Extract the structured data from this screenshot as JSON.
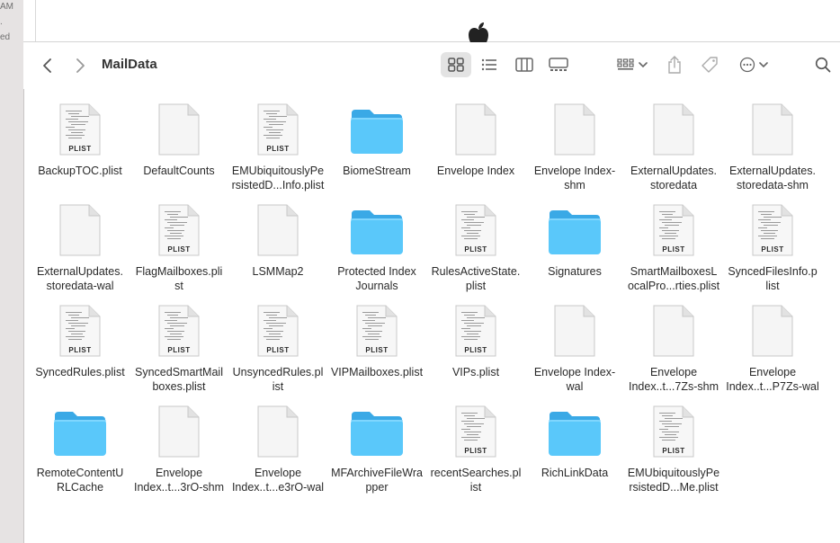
{
  "behind_window": {
    "left_fragments": [
      "AM",
      ".",
      "ed"
    ]
  },
  "toolbar": {
    "title": "MailData",
    "back_icon": "chevron-left-icon",
    "forward_icon": "chevron-right-icon",
    "view_icons": [
      "icon-view-icon",
      "list-view-icon",
      "column-view-icon",
      "gallery-view-icon"
    ],
    "active_view": "icon-view-icon",
    "group_icon": "group-by-icon",
    "share_icon": "share-icon",
    "tag_icon": "tag-icon",
    "more_icon": "more-actions-icon",
    "search_icon": "search-icon"
  },
  "colors": {
    "folder": "#5ac8fa",
    "folder_tab": "#3aa9e6",
    "selected_view_bg": "#e3e3e3"
  },
  "files": [
    {
      "label": "BackupTOC.plist",
      "kind": "plist"
    },
    {
      "label": "DefaultCounts",
      "kind": "blank"
    },
    {
      "label": "EMUbiquitouslyPe\nrsistedD...Info.plist",
      "kind": "plist"
    },
    {
      "label": "BiomeStream",
      "kind": "folder"
    },
    {
      "label": "Envelope Index",
      "kind": "blank"
    },
    {
      "label": "Envelope Index-\nshm",
      "kind": "blank"
    },
    {
      "label": "ExternalUpdates.\nstoredata",
      "kind": "blank"
    },
    {
      "label": "ExternalUpdates.\nstoredata-shm",
      "kind": "blank"
    },
    {
      "label": "ExternalUpdates.\nstoredata-wal",
      "kind": "blank"
    },
    {
      "label": "FlagMailboxes.pli\nst",
      "kind": "plist"
    },
    {
      "label": "LSMMap2",
      "kind": "blank"
    },
    {
      "label": "Protected Index\nJournals",
      "kind": "folder"
    },
    {
      "label": "RulesActiveState.\nplist",
      "kind": "plist"
    },
    {
      "label": "Signatures",
      "kind": "folder"
    },
    {
      "label": "SmartMailboxesL\nocalPro...rties.plist",
      "kind": "plist"
    },
    {
      "label": "SyncedFilesInfo.p\nlist",
      "kind": "plist"
    },
    {
      "label": "SyncedRules.plist",
      "kind": "plist"
    },
    {
      "label": "SyncedSmartMail\nboxes.plist",
      "kind": "plist"
    },
    {
      "label": "UnsyncedRules.pl\nist",
      "kind": "plist"
    },
    {
      "label": "VIPMailboxes.plist",
      "kind": "plist"
    },
    {
      "label": "VIPs.plist",
      "kind": "plist"
    },
    {
      "label": "Envelope Index-\nwal",
      "kind": "blank"
    },
    {
      "label": "Envelope\nIndex..t...7Zs-shm",
      "kind": "blank"
    },
    {
      "label": "Envelope\nIndex..t...P7Zs-wal",
      "kind": "blank"
    },
    {
      "label": "RemoteContentU\nRLCache",
      "kind": "folder"
    },
    {
      "label": "Envelope\nIndex..t...3rO-shm",
      "kind": "blank"
    },
    {
      "label": "Envelope\nIndex..t...e3rO-wal",
      "kind": "blank"
    },
    {
      "label": "MFArchiveFileWra\npper",
      "kind": "folder"
    },
    {
      "label": "recentSearches.pl\nist",
      "kind": "plist"
    },
    {
      "label": "RichLinkData",
      "kind": "folder"
    },
    {
      "label": "EMUbiquitouslyPe\nrsistedD...Me.plist",
      "kind": "plist"
    }
  ],
  "plist_badge": "PLIST"
}
